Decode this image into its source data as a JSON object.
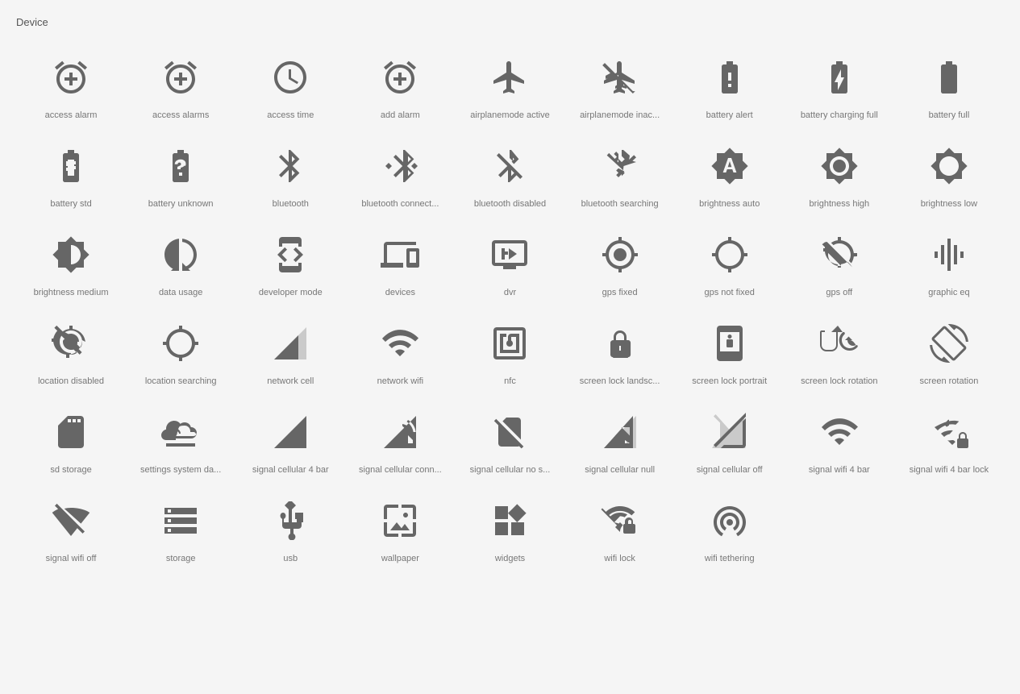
{
  "section": {
    "title": "Device"
  },
  "icons": [
    {
      "id": "access-alarm",
      "label": "access alarm"
    },
    {
      "id": "access-alarms",
      "label": "access alarms"
    },
    {
      "id": "access-time",
      "label": "access time"
    },
    {
      "id": "add-alarm",
      "label": "add alarm"
    },
    {
      "id": "airplanemode-active",
      "label": "airplanemode active"
    },
    {
      "id": "airplanemode-inactive",
      "label": "airplanemode inac..."
    },
    {
      "id": "battery-alert",
      "label": "battery alert"
    },
    {
      "id": "battery-charging-full",
      "label": "battery charging full"
    },
    {
      "id": "battery-full",
      "label": "battery full"
    },
    {
      "id": "battery-std",
      "label": "battery std"
    },
    {
      "id": "battery-unknown",
      "label": "battery unknown"
    },
    {
      "id": "bluetooth",
      "label": "bluetooth"
    },
    {
      "id": "bluetooth-connected",
      "label": "bluetooth connect..."
    },
    {
      "id": "bluetooth-disabled",
      "label": "bluetooth disabled"
    },
    {
      "id": "bluetooth-searching",
      "label": "bluetooth searching"
    },
    {
      "id": "brightness-auto",
      "label": "brightness auto"
    },
    {
      "id": "brightness-high",
      "label": "brightness high"
    },
    {
      "id": "brightness-low",
      "label": "brightness low"
    },
    {
      "id": "brightness-medium",
      "label": "brightness medium"
    },
    {
      "id": "data-usage",
      "label": "data usage"
    },
    {
      "id": "developer-mode",
      "label": "developer mode"
    },
    {
      "id": "devices",
      "label": "devices"
    },
    {
      "id": "dvr",
      "label": "dvr"
    },
    {
      "id": "gps-fixed",
      "label": "gps fixed"
    },
    {
      "id": "gps-not-fixed",
      "label": "gps not fixed"
    },
    {
      "id": "gps-off",
      "label": "gps off"
    },
    {
      "id": "graphic-eq",
      "label": "graphic eq"
    },
    {
      "id": "location-disabled",
      "label": "location disabled"
    },
    {
      "id": "location-searching",
      "label": "location searching"
    },
    {
      "id": "network-cell",
      "label": "network cell"
    },
    {
      "id": "network-wifi",
      "label": "network wifi"
    },
    {
      "id": "nfc",
      "label": "nfc"
    },
    {
      "id": "screen-lock-landscape",
      "label": "screen lock landsc..."
    },
    {
      "id": "screen-lock-portrait",
      "label": "screen lock portrait"
    },
    {
      "id": "screen-lock-rotation",
      "label": "screen lock rotation"
    },
    {
      "id": "screen-rotation",
      "label": "screen rotation"
    },
    {
      "id": "sd-storage",
      "label": "sd storage"
    },
    {
      "id": "settings-system-daydream",
      "label": "settings system da..."
    },
    {
      "id": "signal-cellular-4bar",
      "label": "signal cellular 4 bar"
    },
    {
      "id": "signal-cellular-connected",
      "label": "signal cellular conn..."
    },
    {
      "id": "signal-cellular-no-sim",
      "label": "signal cellular no s..."
    },
    {
      "id": "signal-cellular-null",
      "label": "signal cellular null"
    },
    {
      "id": "signal-cellular-off",
      "label": "signal cellular off"
    },
    {
      "id": "signal-wifi-4bar",
      "label": "signal wifi 4 bar"
    },
    {
      "id": "signal-wifi-4bar-lock",
      "label": "signal wifi 4 bar lock"
    },
    {
      "id": "signal-wifi-off",
      "label": "signal wifi off"
    },
    {
      "id": "storage",
      "label": "storage"
    },
    {
      "id": "usb",
      "label": "usb"
    },
    {
      "id": "wallpaper",
      "label": "wallpaper"
    },
    {
      "id": "widgets",
      "label": "widgets"
    },
    {
      "id": "wifi-lock",
      "label": "wifi lock"
    },
    {
      "id": "wifi-tethering",
      "label": "wifi tethering"
    }
  ]
}
